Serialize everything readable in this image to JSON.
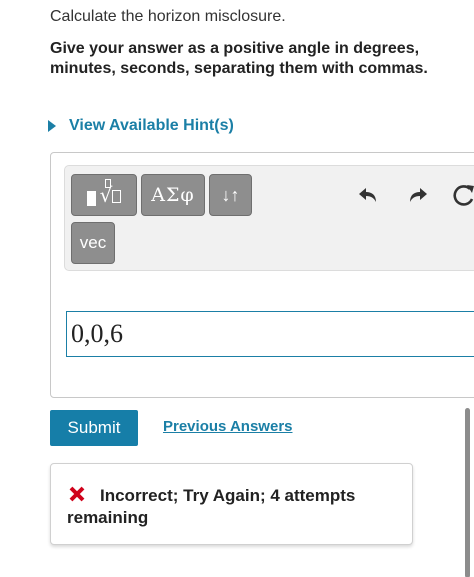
{
  "question": {
    "text": "Calculate the horizon misclosure.",
    "instructions": "Give your answer as a positive angle in degrees, minutes, seconds, separating them with commas."
  },
  "hint": {
    "label": "View Available Hint(s)"
  },
  "toolbar": {
    "greek_label": "ΑΣφ",
    "subsup_label": "↓↑",
    "vec_label": "vec",
    "icons": [
      "templates-icon",
      "undo-icon",
      "redo-icon",
      "reset-icon"
    ]
  },
  "answer": {
    "value": "0,0,6"
  },
  "actions": {
    "submit_label": "Submit",
    "previous_answers_label": "Previous Answers"
  },
  "feedback": {
    "status": "Incorrect; Try Again; 4 attempts remaining",
    "status_color": "#d0021b"
  },
  "colors": {
    "accent": "#1b7fa6",
    "submit_bg": "#167ea8",
    "toolbar_button": "#8e8e8e"
  }
}
